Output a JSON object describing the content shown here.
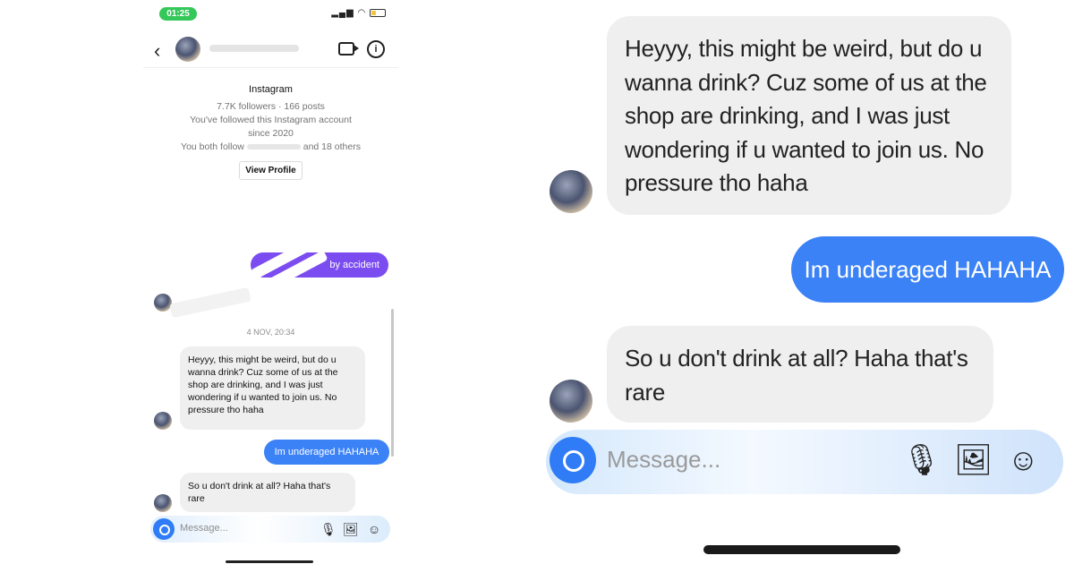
{
  "status_bar": {
    "time": "01:25"
  },
  "profile": {
    "platform_label": "Instagram",
    "stats": "7.7K followers · 166 posts",
    "follow_note_line1": "You've followed this Instagram account",
    "follow_note_line2": "since 2020",
    "mutual_prefix": "You both follow",
    "mutual_suffix": "and 18 others",
    "view_profile_label": "View Profile"
  },
  "thread": {
    "earlier_sent_fragment": "by accident",
    "date_stamp": "4 NOV, 20:34",
    "messages": [
      {
        "from": "them",
        "text": "Heyyy, this might be weird, but do u wanna drink? Cuz some of us at the shop are drinking, and I was just wondering if u wanted to join us. No pressure tho haha"
      },
      {
        "from": "me",
        "text": "Im underaged HAHAHA"
      },
      {
        "from": "them",
        "text": "So u don't drink at all? Haha that's rare"
      }
    ]
  },
  "composer": {
    "placeholder": "Message...",
    "icons": [
      "camera-icon",
      "microphone-icon",
      "image-icon",
      "sticker-icon"
    ]
  },
  "colors": {
    "sent_bubble": "#3b82f6",
    "received_bubble": "#efefef",
    "earlier_sent_bubble": "#7b4df0",
    "time_pill": "#34c759",
    "camera_button": "#2f7cf6"
  }
}
